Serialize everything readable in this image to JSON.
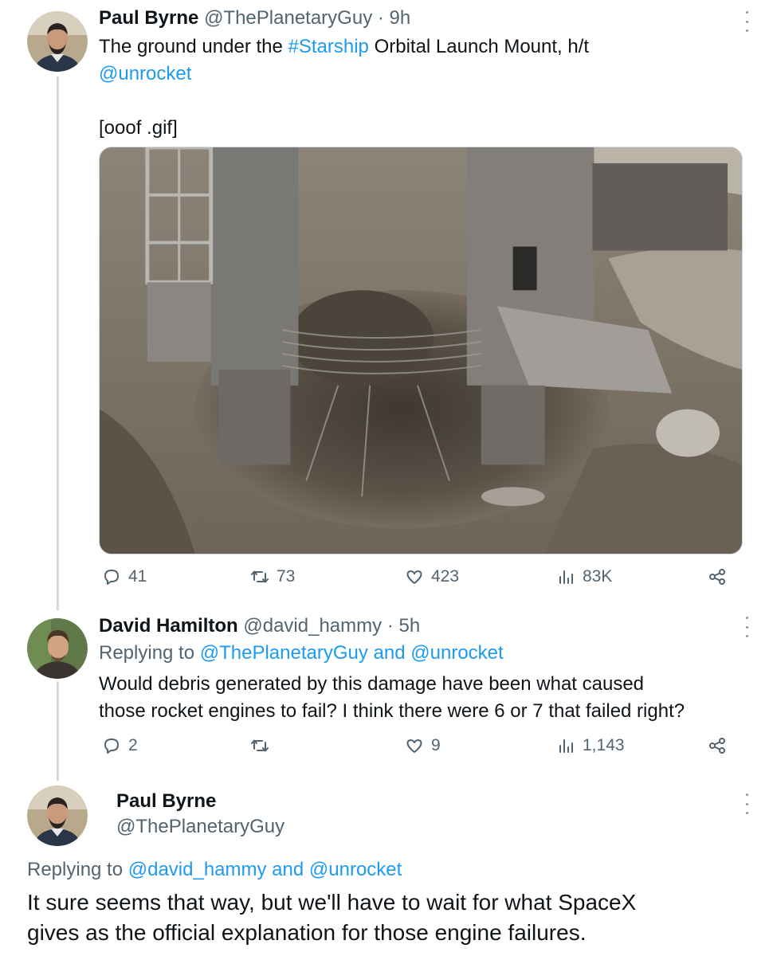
{
  "tweet1": {
    "author_name": "Paul Byrne",
    "author_handle": "@ThePlanetaryGuy",
    "separator": "·",
    "time": "9h",
    "text_before_hashtag": "The ground under the ",
    "hashtag": "#Starship",
    "text_after_hashtag": " Orbital Launch Mount, h/t",
    "mention": "@unrocket",
    "gif_caption": "[ooof .gif]",
    "stats": {
      "replies": "41",
      "retweets": "73",
      "likes": "423",
      "views": "83K"
    }
  },
  "tweet2": {
    "author_name": "David Hamilton",
    "author_handle": "@david_hammy",
    "separator": "·",
    "time": "5h",
    "replying_prefix": "Replying to ",
    "replying_to_1": "@ThePlanetaryGuy",
    "replying_and": " and ",
    "replying_to_2": "@unrocket",
    "text_line1": "Would debris generated by this damage have been what caused",
    "text_line2": "those rocket engines to fail? I think there were 6 or 7 that failed right?",
    "stats": {
      "replies": "2",
      "retweets": "",
      "likes": "9",
      "views": "1,143"
    }
  },
  "tweet3": {
    "author_name": "Paul Byrne",
    "author_handle": "@ThePlanetaryGuy",
    "replying_prefix": "Replying to ",
    "replying_to_1": "@david_hammy",
    "replying_and": " and ",
    "replying_to_2": "@unrocket",
    "text_line1": "It sure seems that way, but we'll have to wait for what SpaceX",
    "text_line2": "gives as the official explanation for those engine failures."
  },
  "colors": {
    "link": "#1d9bf0",
    "muted": "#536471",
    "text": "#0f1419",
    "thread_line": "#cfd9de"
  },
  "icons": [
    "reply-icon",
    "retweet-icon",
    "like-icon",
    "views-icon",
    "share-icon",
    "more-icon"
  ]
}
